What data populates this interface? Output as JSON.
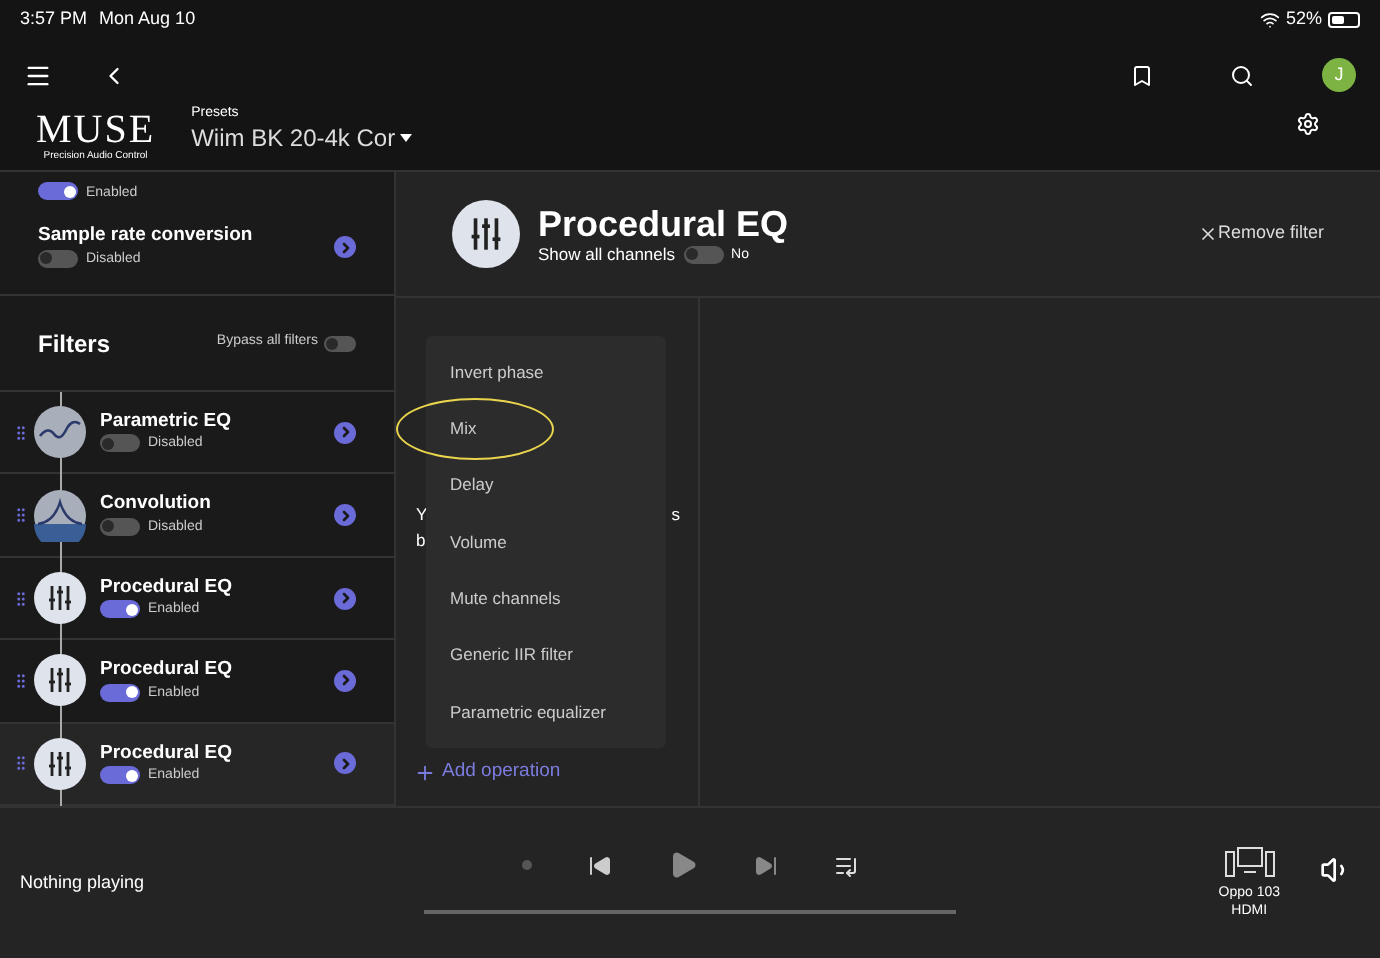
{
  "status_bar": {
    "time": "3:57 PM",
    "date": "Mon Aug 10",
    "battery": "52%"
  },
  "header": {
    "avatar": "J",
    "logo": "MUSE",
    "logo_tagline": "Precision Audio Control",
    "presets_label": "Presets",
    "preset": "Wiim BK 20-4k Cor"
  },
  "sidebar": {
    "top_item": {
      "status": "Enabled",
      "enabled": true
    },
    "sample_rate": {
      "name": "Sample rate conversion",
      "status": "Disabled",
      "enabled": false
    },
    "filters_title": "Filters",
    "bypass_label": "Bypass all filters",
    "bypass": false,
    "filters": [
      {
        "kind": "parametric",
        "name": "Parametric EQ",
        "status": "Disabled",
        "enabled": false,
        "selected": false
      },
      {
        "kind": "convolution",
        "name": "Convolution",
        "status": "Disabled",
        "enabled": false,
        "selected": false
      },
      {
        "kind": "procedural",
        "name": "Procedural EQ",
        "status": "Enabled",
        "enabled": true,
        "selected": false
      },
      {
        "kind": "procedural",
        "name": "Procedural EQ",
        "status": "Enabled",
        "enabled": true,
        "selected": false
      },
      {
        "kind": "procedural",
        "name": "Procedural EQ",
        "status": "Enabled",
        "enabled": true,
        "selected": true
      }
    ]
  },
  "detail": {
    "title": "Procedural EQ",
    "show_all_label": "Show all channels",
    "show_all": false,
    "show_all_value": "No",
    "remove": "Remove filter",
    "hidden_fragments": [
      "Y",
      "s",
      "b"
    ],
    "menu": [
      {
        "label": "Invert phase",
        "circled": false
      },
      {
        "label": "Mix",
        "circled": true
      },
      {
        "label": "Delay",
        "circled": false
      },
      {
        "label": "Volume",
        "circled": false
      },
      {
        "label": "Mute channels",
        "circled": false
      },
      {
        "label": "Generic IIR filter",
        "circled": false
      },
      {
        "label": "Parametric equalizer",
        "circled": false
      }
    ],
    "add_operation": "Add operation"
  },
  "player": {
    "now_playing": "Nothing playing",
    "progress": {
      "level": 0
    },
    "device_line1": "Oppo 103",
    "device_line2": "HDMI"
  }
}
